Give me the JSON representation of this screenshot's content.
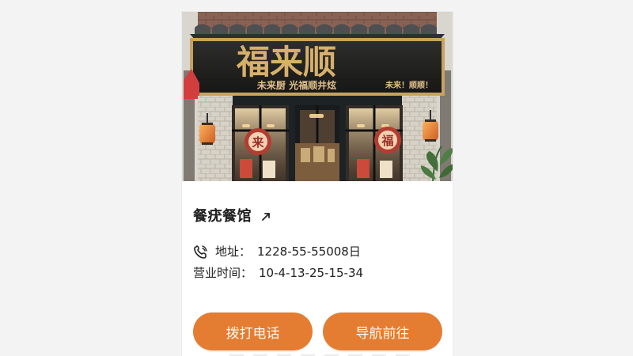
{
  "storefront": {
    "sign_main": "福来顺",
    "sign_sub_left": "未来厨 光福顺井炫",
    "sign_sub_right": "未来！顺顺！",
    "lantern_left": "来",
    "lantern_right": "福"
  },
  "restaurant": {
    "name": "餐疣餐馆",
    "address_label": "地址：",
    "address_value": "1228-55-55008日",
    "hours_label": "营业时间：",
    "hours_value": "10-4-13-25-15-34"
  },
  "actions": {
    "call_label": "拨打电话",
    "navigate_label": "导航前往"
  },
  "colors": {
    "accent": "#e47d32",
    "text": "#202020",
    "background": "#f3f3f3",
    "card": "#ffffff"
  },
  "icons": {
    "external_link": "arrow-up-right-icon",
    "phone": "phone-icon"
  }
}
